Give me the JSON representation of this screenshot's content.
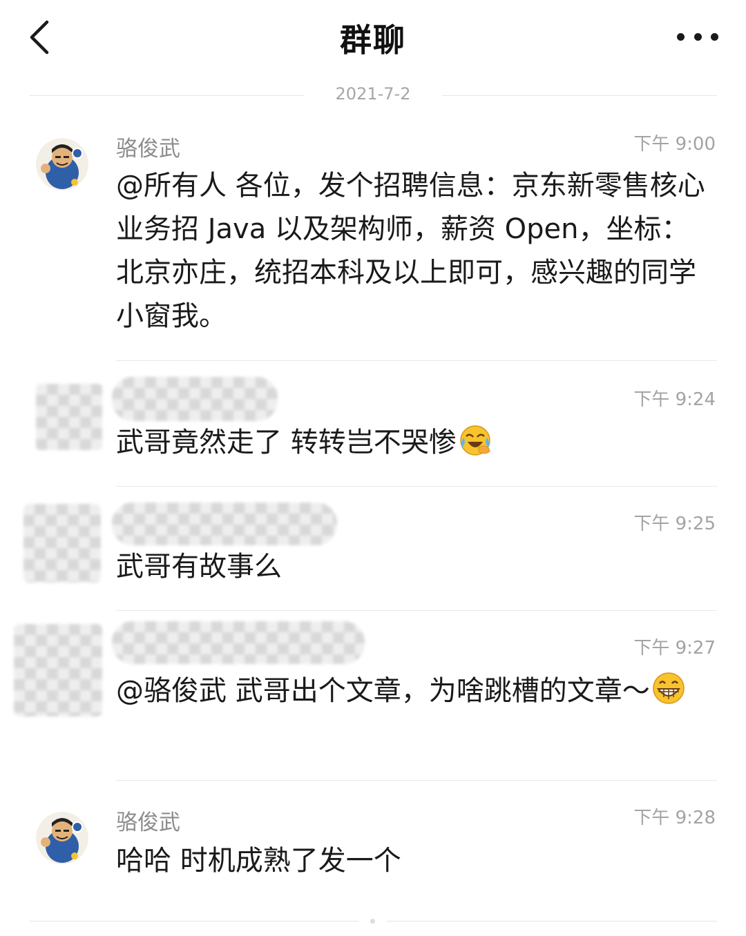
{
  "header": {
    "title": "群聊",
    "back_icon": "chevron-left-icon",
    "more_icon": "more-horizontal-icon"
  },
  "date_divider": "2021-7-2",
  "messages": [
    {
      "sender": "骆俊武",
      "time": "下午 9:00",
      "text": "@所有人 各位，发个招聘信息：京东新零售核心业务招 Java 以及架构师，薪资 Open，坐标：北京亦庄，统招本科及以上即可，感兴趣的同学小窗我。"
    },
    {
      "sender": "",
      "time": "下午 9:24",
      "text": "武哥竟然走了 转转岂不哭惨",
      "emoji": "face-crying-laughing-icon"
    },
    {
      "sender": "",
      "time": "下午 9:25",
      "text": "武哥有故事么"
    },
    {
      "sender": "",
      "time": "下午 9:27",
      "text": "@骆俊武 武哥出个文章，为啥跳槽的文章～",
      "emoji": "grinning-face-icon"
    },
    {
      "sender": "骆俊武",
      "time": "下午 9:28",
      "text": "哈哈 时机成熟了发一个"
    }
  ],
  "colors": {
    "text": "#1a1a1a",
    "secondary": "#8c8c8c",
    "divider": "#e8e8e8",
    "background": "#ffffff"
  }
}
